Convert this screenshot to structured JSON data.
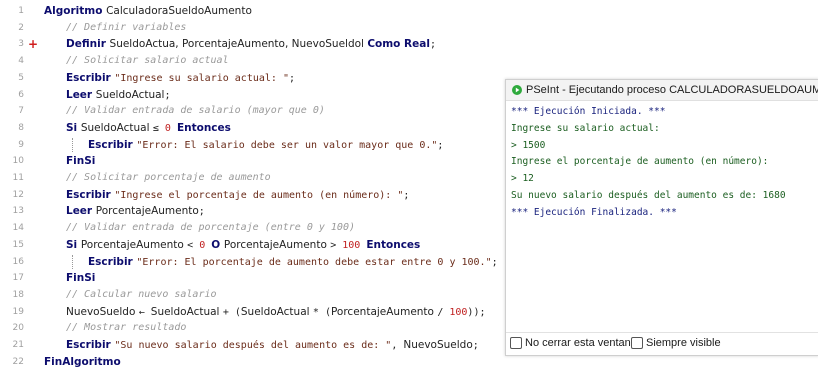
{
  "editor": {
    "lines": [
      {
        "n": "1",
        "marker": "",
        "tokens": [
          [
            "k",
            "Algoritmo "
          ],
          [
            "i",
            "CalculadoraSueldoAumento"
          ]
        ]
      },
      {
        "n": "2",
        "marker": "",
        "tokens": [
          [
            "c",
            "// Definir variables"
          ]
        ]
      },
      {
        "n": "3",
        "marker": "+",
        "tokens": [
          [
            "k",
            "Definir "
          ],
          [
            "i",
            "SueldoActua, PorcentajeAumento, NuevoSueldol "
          ],
          [
            "k",
            "Como Real"
          ],
          [
            "o",
            ";"
          ]
        ]
      },
      {
        "n": "4",
        "marker": "",
        "tokens": [
          [
            "c",
            "// Solicitar salario actual"
          ]
        ]
      },
      {
        "n": "5",
        "marker": "",
        "tokens": [
          [
            "k",
            "Escribir "
          ],
          [
            "s",
            "\"Ingrese su salario actual: \""
          ],
          [
            "o",
            ";"
          ]
        ]
      },
      {
        "n": "6",
        "marker": "",
        "tokens": [
          [
            "k",
            "Leer "
          ],
          [
            "i",
            "SueldoActual"
          ],
          [
            "o",
            ";"
          ]
        ]
      },
      {
        "n": "7",
        "marker": "",
        "tokens": [
          [
            "c",
            "// Validar entrada de salario (mayor que 0)"
          ]
        ]
      },
      {
        "n": "8",
        "marker": "",
        "tokens": [
          [
            "k",
            "Si "
          ],
          [
            "i",
            "SueldoActual "
          ],
          [
            "o",
            "≤ "
          ],
          [
            "n",
            "0 "
          ],
          [
            "k",
            "Entonces"
          ]
        ]
      },
      {
        "n": "9",
        "marker": "",
        "tokens": [
          [
            "k",
            "Escribir "
          ],
          [
            "s",
            "\"Error: El salario debe ser un valor mayor que 0.\""
          ],
          [
            "o",
            ";"
          ]
        ]
      },
      {
        "n": "10",
        "marker": "",
        "tokens": [
          [
            "k",
            "FinSi"
          ]
        ]
      },
      {
        "n": "11",
        "marker": "",
        "tokens": [
          [
            "c",
            "// Solicitar porcentaje de aumento"
          ]
        ]
      },
      {
        "n": "12",
        "marker": "",
        "tokens": [
          [
            "k",
            "Escribir "
          ],
          [
            "s",
            "\"Ingrese el porcentaje de aumento (en número): \""
          ],
          [
            "o",
            ";"
          ]
        ]
      },
      {
        "n": "13",
        "marker": "",
        "tokens": [
          [
            "k",
            "Leer "
          ],
          [
            "i",
            "PorcentajeAumento"
          ],
          [
            "o",
            ";"
          ]
        ]
      },
      {
        "n": "14",
        "marker": "",
        "tokens": [
          [
            "c",
            "// Validar entrada de porcentaje (entre 0 y 100)"
          ]
        ]
      },
      {
        "n": "15",
        "marker": "",
        "tokens": [
          [
            "k",
            "Si "
          ],
          [
            "i",
            "PorcentajeAumento "
          ],
          [
            "o",
            "< "
          ],
          [
            "n",
            "0 "
          ],
          [
            "k",
            "O "
          ],
          [
            "i",
            "PorcentajeAumento "
          ],
          [
            "o",
            "> "
          ],
          [
            "n",
            "100 "
          ],
          [
            "k",
            "Entonces"
          ]
        ]
      },
      {
        "n": "16",
        "marker": "",
        "tokens": [
          [
            "k",
            "Escribir "
          ],
          [
            "s",
            "\"Error: El porcentaje de aumento debe estar entre 0 y 100.\""
          ],
          [
            "o",
            ";"
          ]
        ]
      },
      {
        "n": "17",
        "marker": "",
        "tokens": [
          [
            "k",
            "FinSi"
          ]
        ]
      },
      {
        "n": "18",
        "marker": "",
        "tokens": [
          [
            "c",
            "// Calcular nuevo salario"
          ]
        ]
      },
      {
        "n": "19",
        "marker": "",
        "tokens": [
          [
            "i",
            "NuevoSueldo "
          ],
          [
            "o",
            "← "
          ],
          [
            "i",
            "SueldoActual "
          ],
          [
            "o",
            "+ ("
          ],
          [
            "i",
            "SueldoActual "
          ],
          [
            "o",
            "* ("
          ],
          [
            "i",
            "PorcentajeAumento "
          ],
          [
            "o",
            "/ "
          ],
          [
            "n",
            "100"
          ],
          [
            "o",
            "));"
          ]
        ]
      },
      {
        "n": "20",
        "marker": "",
        "tokens": [
          [
            "c",
            "// Mostrar resultado"
          ]
        ]
      },
      {
        "n": "21",
        "marker": "",
        "tokens": [
          [
            "k",
            "Escribir "
          ],
          [
            "s",
            "\"Su nuevo salario después del aumento es de: \""
          ],
          [
            "o",
            ", "
          ],
          [
            "i",
            "NuevoSueldo"
          ],
          [
            "o",
            ";"
          ]
        ]
      },
      {
        "n": "22",
        "marker": "",
        "tokens": [
          [
            "k",
            "FinAlgoritmo"
          ]
        ]
      }
    ]
  },
  "run_window": {
    "title": "PSeInt - Ejecutando proceso CALCULADORASUELDOAUMENTO",
    "console": [
      {
        "kind": "sys",
        "text": "*** Ejecución Iniciada. ***"
      },
      {
        "kind": "out",
        "text": "Ingrese su salario actual:"
      },
      {
        "kind": "in",
        "text": "> 1500"
      },
      {
        "kind": "out",
        "text": "Ingrese el porcentaje de aumento (en número):"
      },
      {
        "kind": "in",
        "text": "> 12"
      },
      {
        "kind": "out",
        "text": "Su nuevo salario después del aumento es de: 1680"
      },
      {
        "kind": "sys",
        "text": "*** Ejecución Finalizada. ***"
      }
    ],
    "no_close_label": "No cerrar esta ventana",
    "always_visible_label": "Siempre visible"
  },
  "colors": {
    "keyword": "#0c0c6d",
    "string": "#6b2c1a",
    "comment": "#9a9a9a",
    "number": "#c02020",
    "app_icon": "#2eaa3c"
  }
}
